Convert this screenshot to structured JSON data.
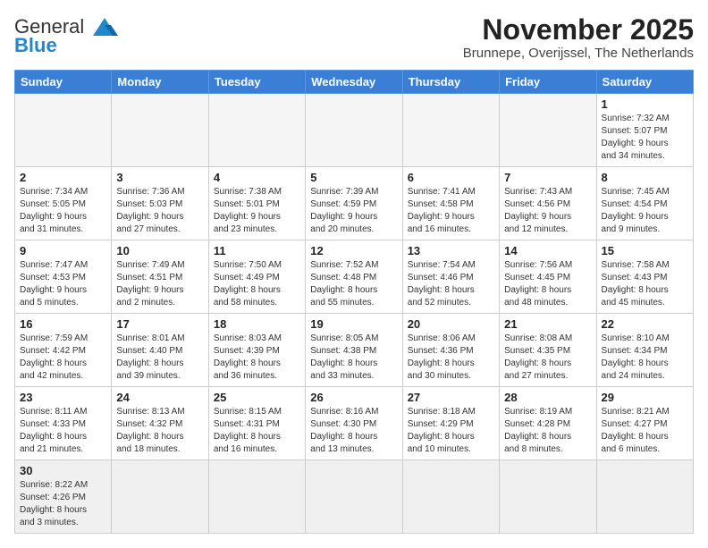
{
  "logo": {
    "general": "General",
    "blue": "Blue"
  },
  "title": "November 2025",
  "location": "Brunnepe, Overijssel, The Netherlands",
  "weekdays": [
    "Sunday",
    "Monday",
    "Tuesday",
    "Wednesday",
    "Thursday",
    "Friday",
    "Saturday"
  ],
  "days": [
    {
      "num": "",
      "info": ""
    },
    {
      "num": "",
      "info": ""
    },
    {
      "num": "",
      "info": ""
    },
    {
      "num": "",
      "info": ""
    },
    {
      "num": "",
      "info": ""
    },
    {
      "num": "",
      "info": ""
    },
    {
      "num": "1",
      "info": "Sunrise: 7:32 AM\nSunset: 5:07 PM\nDaylight: 9 hours\nand 34 minutes."
    },
    {
      "num": "2",
      "info": "Sunrise: 7:34 AM\nSunset: 5:05 PM\nDaylight: 9 hours\nand 31 minutes."
    },
    {
      "num": "3",
      "info": "Sunrise: 7:36 AM\nSunset: 5:03 PM\nDaylight: 9 hours\nand 27 minutes."
    },
    {
      "num": "4",
      "info": "Sunrise: 7:38 AM\nSunset: 5:01 PM\nDaylight: 9 hours\nand 23 minutes."
    },
    {
      "num": "5",
      "info": "Sunrise: 7:39 AM\nSunset: 4:59 PM\nDaylight: 9 hours\nand 20 minutes."
    },
    {
      "num": "6",
      "info": "Sunrise: 7:41 AM\nSunset: 4:58 PM\nDaylight: 9 hours\nand 16 minutes."
    },
    {
      "num": "7",
      "info": "Sunrise: 7:43 AM\nSunset: 4:56 PM\nDaylight: 9 hours\nand 12 minutes."
    },
    {
      "num": "8",
      "info": "Sunrise: 7:45 AM\nSunset: 4:54 PM\nDaylight: 9 hours\nand 9 minutes."
    },
    {
      "num": "9",
      "info": "Sunrise: 7:47 AM\nSunset: 4:53 PM\nDaylight: 9 hours\nand 5 minutes."
    },
    {
      "num": "10",
      "info": "Sunrise: 7:49 AM\nSunset: 4:51 PM\nDaylight: 9 hours\nand 2 minutes."
    },
    {
      "num": "11",
      "info": "Sunrise: 7:50 AM\nSunset: 4:49 PM\nDaylight: 8 hours\nand 58 minutes."
    },
    {
      "num": "12",
      "info": "Sunrise: 7:52 AM\nSunset: 4:48 PM\nDaylight: 8 hours\nand 55 minutes."
    },
    {
      "num": "13",
      "info": "Sunrise: 7:54 AM\nSunset: 4:46 PM\nDaylight: 8 hours\nand 52 minutes."
    },
    {
      "num": "14",
      "info": "Sunrise: 7:56 AM\nSunset: 4:45 PM\nDaylight: 8 hours\nand 48 minutes."
    },
    {
      "num": "15",
      "info": "Sunrise: 7:58 AM\nSunset: 4:43 PM\nDaylight: 8 hours\nand 45 minutes."
    },
    {
      "num": "16",
      "info": "Sunrise: 7:59 AM\nSunset: 4:42 PM\nDaylight: 8 hours\nand 42 minutes."
    },
    {
      "num": "17",
      "info": "Sunrise: 8:01 AM\nSunset: 4:40 PM\nDaylight: 8 hours\nand 39 minutes."
    },
    {
      "num": "18",
      "info": "Sunrise: 8:03 AM\nSunset: 4:39 PM\nDaylight: 8 hours\nand 36 minutes."
    },
    {
      "num": "19",
      "info": "Sunrise: 8:05 AM\nSunset: 4:38 PM\nDaylight: 8 hours\nand 33 minutes."
    },
    {
      "num": "20",
      "info": "Sunrise: 8:06 AM\nSunset: 4:36 PM\nDaylight: 8 hours\nand 30 minutes."
    },
    {
      "num": "21",
      "info": "Sunrise: 8:08 AM\nSunset: 4:35 PM\nDaylight: 8 hours\nand 27 minutes."
    },
    {
      "num": "22",
      "info": "Sunrise: 8:10 AM\nSunset: 4:34 PM\nDaylight: 8 hours\nand 24 minutes."
    },
    {
      "num": "23",
      "info": "Sunrise: 8:11 AM\nSunset: 4:33 PM\nDaylight: 8 hours\nand 21 minutes."
    },
    {
      "num": "24",
      "info": "Sunrise: 8:13 AM\nSunset: 4:32 PM\nDaylight: 8 hours\nand 18 minutes."
    },
    {
      "num": "25",
      "info": "Sunrise: 8:15 AM\nSunset: 4:31 PM\nDaylight: 8 hours\nand 16 minutes."
    },
    {
      "num": "26",
      "info": "Sunrise: 8:16 AM\nSunset: 4:30 PM\nDaylight: 8 hours\nand 13 minutes."
    },
    {
      "num": "27",
      "info": "Sunrise: 8:18 AM\nSunset: 4:29 PM\nDaylight: 8 hours\nand 10 minutes."
    },
    {
      "num": "28",
      "info": "Sunrise: 8:19 AM\nSunset: 4:28 PM\nDaylight: 8 hours\nand 8 minutes."
    },
    {
      "num": "29",
      "info": "Sunrise: 8:21 AM\nSunset: 4:27 PM\nDaylight: 8 hours\nand 6 minutes."
    },
    {
      "num": "30",
      "info": "Sunrise: 8:22 AM\nSunset: 4:26 PM\nDaylight: 8 hours\nand 3 minutes."
    },
    {
      "num": "",
      "info": ""
    },
    {
      "num": "",
      "info": ""
    },
    {
      "num": "",
      "info": ""
    },
    {
      "num": "",
      "info": ""
    },
    {
      "num": "",
      "info": ""
    },
    {
      "num": "",
      "info": ""
    }
  ]
}
